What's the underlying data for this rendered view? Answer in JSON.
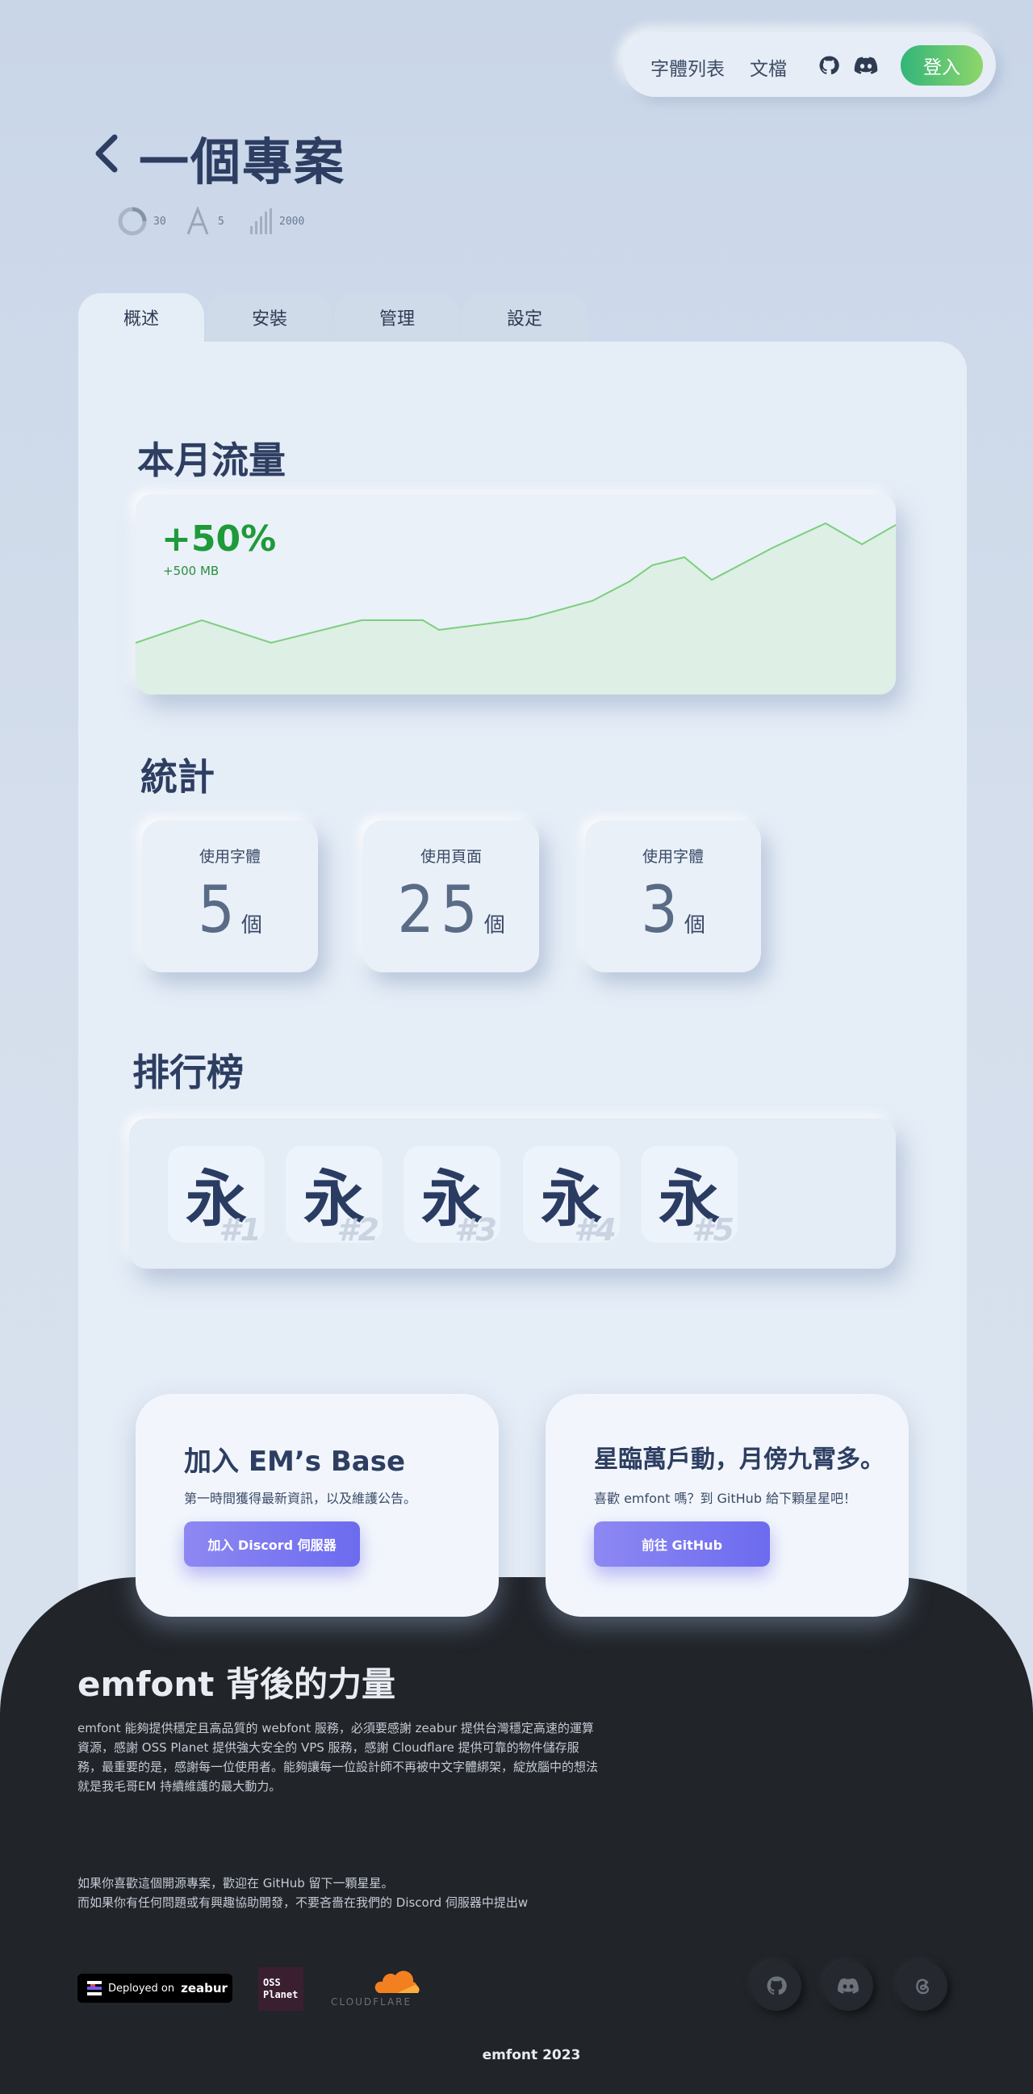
{
  "nav": {
    "font_list": "字體列表",
    "docs": "文檔",
    "login": "登入",
    "icons": [
      "github-icon",
      "discord-icon"
    ]
  },
  "project": {
    "title": "一個專案",
    "meta": [
      {
        "icon": "storage-icon",
        "value": "30"
      },
      {
        "icon": "font-icon",
        "value": "5"
      },
      {
        "icon": "bars-icon",
        "value": "2000"
      }
    ]
  },
  "tabs": [
    "概述",
    "安裝",
    "管理",
    "設定"
  ],
  "traffic": {
    "title": "本月流量",
    "percent": "+50%",
    "amount": "+500 MB",
    "accent": "#1f9a3a"
  },
  "stats": {
    "title": "統計",
    "items": [
      {
        "label": "使用字體",
        "value": "5",
        "unit": "個"
      },
      {
        "label": "使用頁面",
        "value": "25",
        "unit": "個"
      },
      {
        "label": "使用字體",
        "value": "3",
        "unit": "個"
      }
    ]
  },
  "ranking": {
    "title": "排行榜",
    "items": [
      {
        "glyph": "永",
        "rank": "#1"
      },
      {
        "glyph": "永",
        "rank": "#2"
      },
      {
        "glyph": "永",
        "rank": "#3"
      },
      {
        "glyph": "永",
        "rank": "#4"
      },
      {
        "glyph": "永",
        "rank": "#5"
      }
    ]
  },
  "cta": {
    "discord": {
      "title": "加入 EM’s Base",
      "desc": "第一時間獲得最新資訊，以及維護公告。",
      "button": "加入 Discord 伺服器"
    },
    "github": {
      "title": "星臨萬戶動，月傍九霄多。",
      "desc": "喜歡 emfont 嗎？到 GitHub 給下顆星星吧！",
      "button": "前往 GitHub"
    }
  },
  "footer": {
    "title": "emfont 背後的力量",
    "paragraph": "emfont 能夠提供穩定且高品質的 webfont 服務，必須要感謝 zeabur 提供台灣穩定高速的運算資源，感謝 OSS Planet 提供強大安全的 VPS 服務，感謝 Cloudflare 提供可靠的物件儲存服務，最重要的是，感謝每一位使用者。能夠讓每一位設計師不再被中文字體綁架，綻放腦中的想法就是我毛哥EM 持續維護的最大動力。",
    "line1": "如果你喜歡這個開源專案，歡迎在 GitHub 留下一顆星星。",
    "line2": "而如果你有任何問題或有興趣協助開發，不要吝嗇在我們的 Discord 伺服器中提出w",
    "zeabur_prefix": "Deployed on",
    "zeabur_brand": "zeabur",
    "oss_line1": "OSS",
    "oss_line2": "Planet",
    "cloudflare": "CLOUDFLARE",
    "socials": [
      "github-icon",
      "discord-icon",
      "threads-icon"
    ],
    "copyright": "emfont 2023"
  }
}
